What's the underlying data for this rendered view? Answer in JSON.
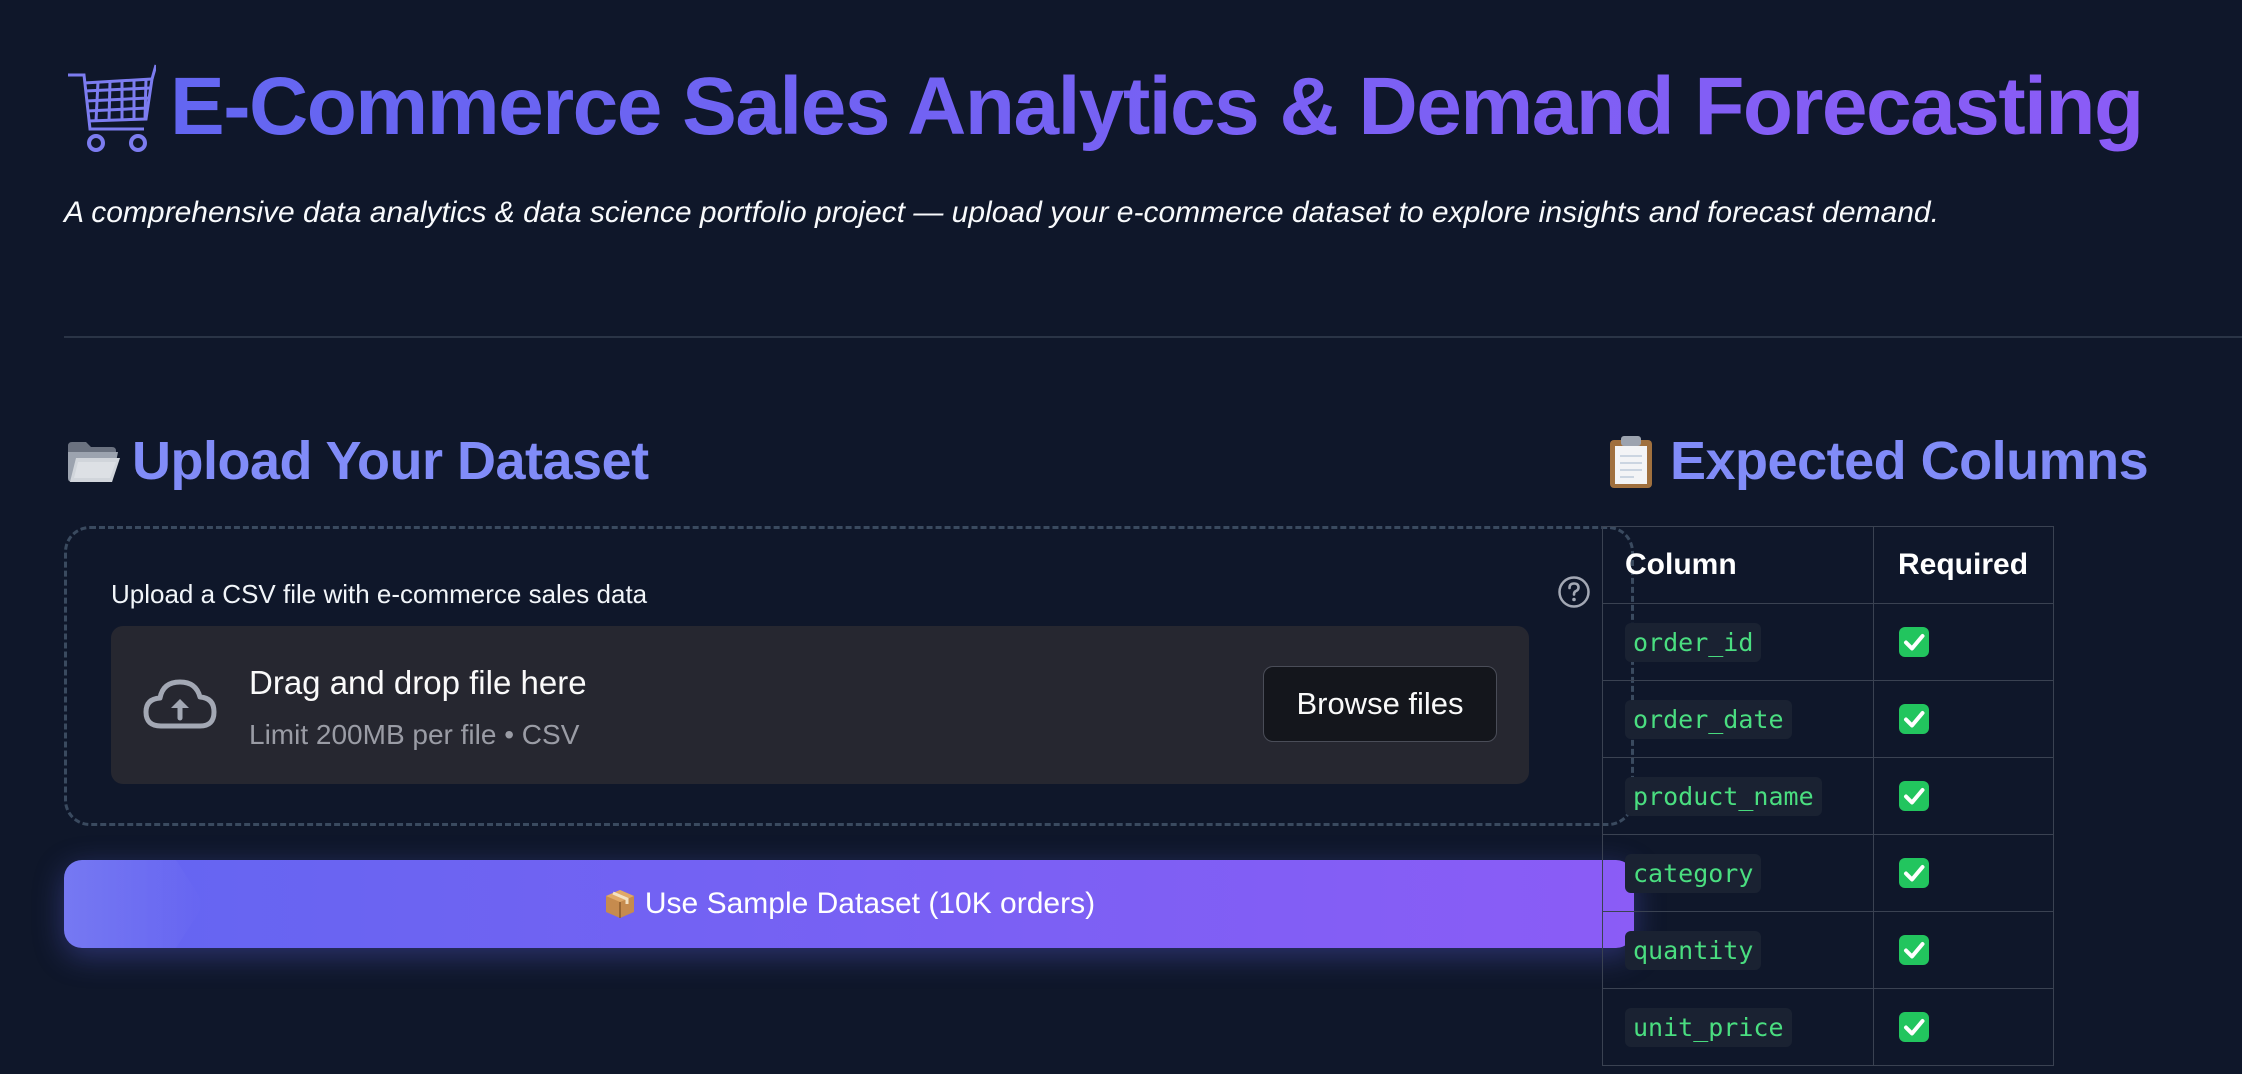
{
  "header": {
    "title": "E-Commerce Sales Analytics & Demand Forecasting",
    "title_icon": "shopping-cart-icon",
    "subtitle": "A comprehensive data analytics & data science portfolio project — upload your e-commerce dataset to explore insights and forecast demand."
  },
  "upload_section": {
    "title": "Upload Your Dataset",
    "title_icon": "folder-icon",
    "uploader": {
      "label": "Upload a CSV file with e-commerce sales data",
      "drop_text": "Drag and drop file here",
      "limit_text": "Limit 200MB per file • CSV",
      "browse_label": "Browse files"
    },
    "sample_button": {
      "label": "Use Sample Dataset (10K orders)",
      "icon": "package-icon"
    }
  },
  "expected_section": {
    "title": "Expected Columns",
    "title_icon": "clipboard-icon",
    "headers": [
      "Column",
      "Required"
    ],
    "rows": [
      {
        "column": "order_id",
        "required": "✅"
      },
      {
        "column": "order_date",
        "required": "✅"
      },
      {
        "column": "product_name",
        "required": "✅"
      },
      {
        "column": "category",
        "required": "✅"
      },
      {
        "column": "quantity",
        "required": "✅"
      },
      {
        "column": "unit_price",
        "required": "✅"
      }
    ]
  },
  "colors": {
    "background": "#0f172a",
    "accent_start": "#6366f1",
    "accent_end": "#8b5cf6",
    "section_title": "#818cf8",
    "code_text": "#4ade80",
    "check_green": "#22c55e"
  }
}
